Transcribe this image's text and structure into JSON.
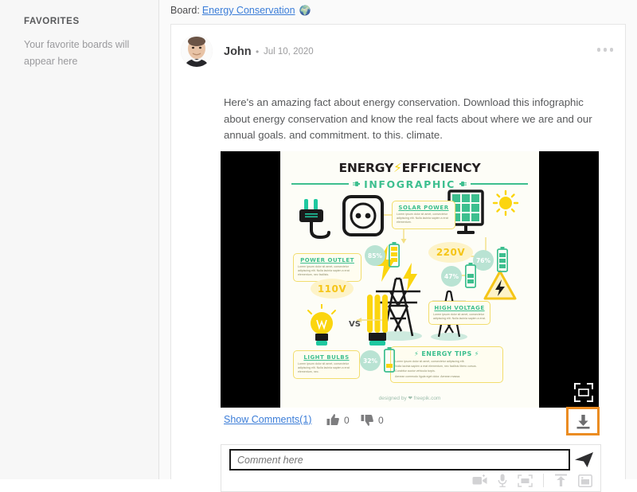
{
  "sidebar": {
    "title": "FAVORITES",
    "empty_message": "Your favorite boards will appear here"
  },
  "board_bar": {
    "label": "Board:",
    "name": "Energy Conservation",
    "icon": "globe-icon",
    "globe_glyph": "🌍"
  },
  "post": {
    "author": "John",
    "separator": "•",
    "date": "Jul 10, 2020",
    "text": "Here's an amazing fact about energy conservation. Download this infographic about energy conservation and know the real facts about where we are and our annual goals. and commitment. to this. climate.",
    "more_menu": "more-options-icon"
  },
  "infographic": {
    "title_part1": "ENERGY",
    "title_bolt": "⚡",
    "title_part2": "EFFICIENCY",
    "subtitle": "INFOGRAPHIC",
    "credit": "designed by ❤ freepik.com",
    "fullscreen": "fullscreen-icon",
    "vs_label": "VS",
    "boxes": [
      {
        "id": "power-outlet",
        "title": "POWER OUTLET",
        "body": "Lorem ipsum dolor sit amet, consectetur adipiscing elit. Nulla lacinia sapien a erat elementum, nec facilisis."
      },
      {
        "id": "solar-power",
        "title": "SOLAR POWER",
        "body": "Lorem ipsum dolor sit amet, consectetur adipiscing elit. Nulla lacinia sapien a erat elementum."
      },
      {
        "id": "high-voltage",
        "title": "HIGH VOLTAGE",
        "body": "Lorem ipsum dolor sit amet, consectetur adipiscing elit. Nulla lacinia sapien a erat."
      },
      {
        "id": "light-bulbs",
        "title": "LIGHT BULBS",
        "body": "Lorem ipsum dolor sit amet, consectetur adipiscing elit. Nulla lacinia sapien a erat elementum, nec."
      }
    ],
    "tips": {
      "title": "ENERGY TIPS",
      "bolt": "⚡",
      "items": [
        "Lorem ipsum dolor sit amet, consectetur adipiscing elit.",
        "Nulla lacinia sapien a erat elementum, nec facilisis libero cursus.",
        "Curabitur auctor vehicula turpis.",
        "Aenean commodo ligula eget dolor. Aenean massa."
      ]
    },
    "percentages": [
      {
        "id": "pct-85",
        "value": "85%"
      },
      {
        "id": "pct-76",
        "value": "76%"
      },
      {
        "id": "pct-47",
        "value": "47%"
      },
      {
        "id": "pct-32",
        "value": "32%"
      }
    ],
    "voltages": [
      {
        "id": "volt-220",
        "value": "220V"
      },
      {
        "id": "volt-110",
        "value": "110V"
      }
    ],
    "colors": {
      "green": "#3dbf8f",
      "yellow": "#f5d416",
      "box_bg": "#fffdf0",
      "box_border": "#f2dd6e",
      "pct_bg": "#b9e3d3"
    }
  },
  "actions": {
    "show_comments": "Show Comments(1)",
    "like_icon": "thumbs-up-icon",
    "like_count": "0",
    "dislike_icon": "thumbs-down-icon",
    "dislike_count": "0",
    "download_icon": "download-icon",
    "highlight_color": "#eb8c22"
  },
  "composer": {
    "placeholder": "Comment here",
    "value": "",
    "send_icon": "send-icon",
    "tools": [
      {
        "id": "video-icon",
        "name": "video-record-icon"
      },
      {
        "id": "mic-icon",
        "name": "microphone-icon"
      },
      {
        "id": "screen-icon",
        "name": "screen-capture-icon"
      },
      {
        "id": "upload-icon",
        "name": "upload-icon"
      },
      {
        "id": "image-icon",
        "name": "image-attach-icon"
      }
    ]
  }
}
